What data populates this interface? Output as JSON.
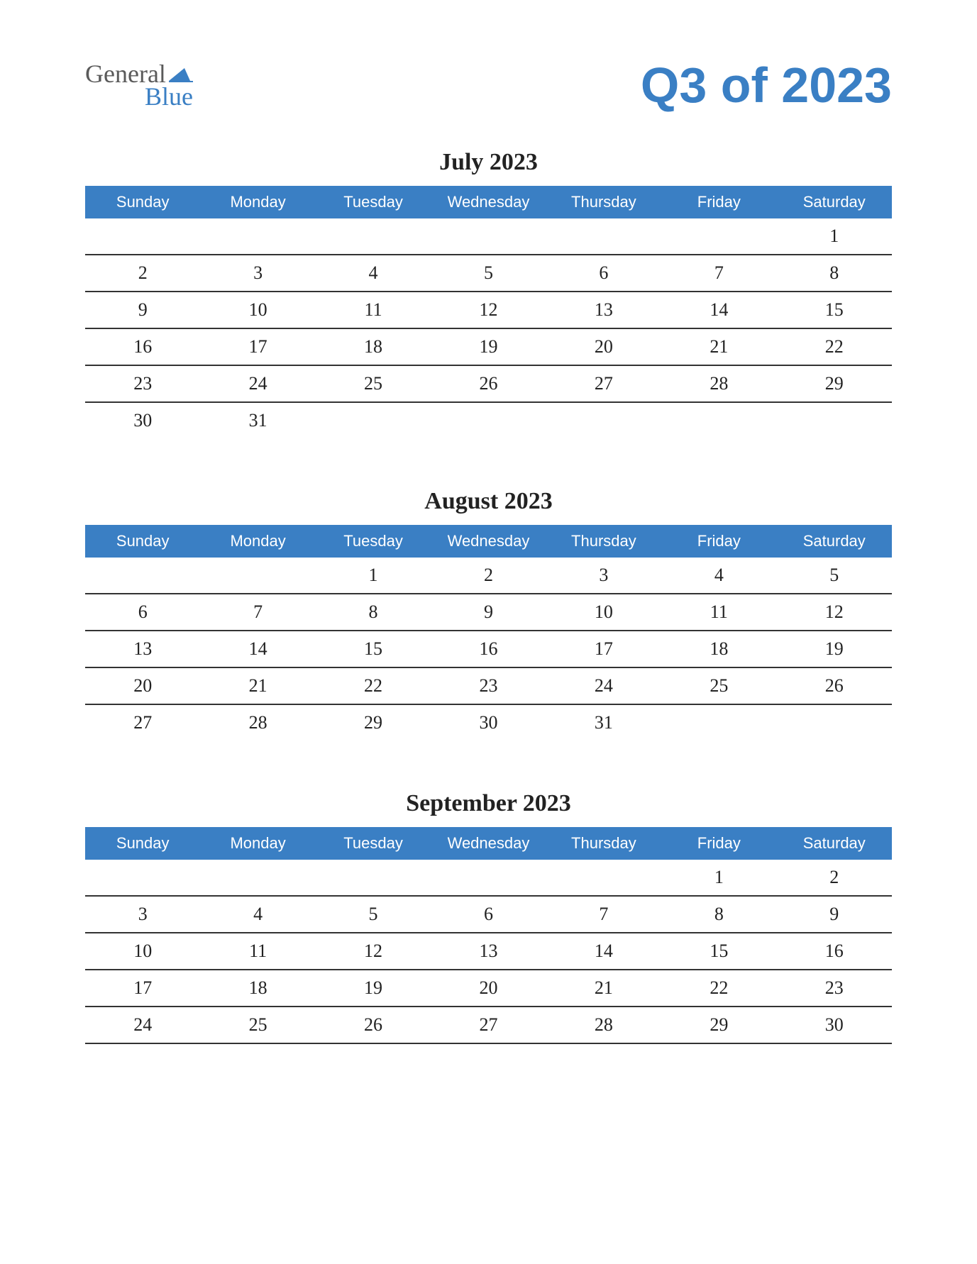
{
  "brand": {
    "word1": "General",
    "word2": "Blue"
  },
  "title": "Q3 of 2023",
  "day_headers": [
    "Sunday",
    "Monday",
    "Tuesday",
    "Wednesday",
    "Thursday",
    "Friday",
    "Saturday"
  ],
  "months": [
    {
      "title": "July 2023",
      "weeks": [
        [
          "",
          "",
          "",
          "",
          "",
          "",
          "1"
        ],
        [
          "2",
          "3",
          "4",
          "5",
          "6",
          "7",
          "8"
        ],
        [
          "9",
          "10",
          "11",
          "12",
          "13",
          "14",
          "15"
        ],
        [
          "16",
          "17",
          "18",
          "19",
          "20",
          "21",
          "22"
        ],
        [
          "23",
          "24",
          "25",
          "26",
          "27",
          "28",
          "29"
        ],
        [
          "30",
          "31",
          "",
          "",
          "",
          "",
          ""
        ]
      ]
    },
    {
      "title": "August 2023",
      "weeks": [
        [
          "",
          "",
          "1",
          "2",
          "3",
          "4",
          "5"
        ],
        [
          "6",
          "7",
          "8",
          "9",
          "10",
          "11",
          "12"
        ],
        [
          "13",
          "14",
          "15",
          "16",
          "17",
          "18",
          "19"
        ],
        [
          "20",
          "21",
          "22",
          "23",
          "24",
          "25",
          "26"
        ],
        [
          "27",
          "28",
          "29",
          "30",
          "31",
          "",
          ""
        ]
      ]
    },
    {
      "title": "September 2023",
      "weeks": [
        [
          "",
          "",
          "",
          "",
          "",
          "1",
          "2"
        ],
        [
          "3",
          "4",
          "5",
          "6",
          "7",
          "8",
          "9"
        ],
        [
          "10",
          "11",
          "12",
          "13",
          "14",
          "15",
          "16"
        ],
        [
          "17",
          "18",
          "19",
          "20",
          "21",
          "22",
          "23"
        ],
        [
          "24",
          "25",
          "26",
          "27",
          "28",
          "29",
          "30"
        ]
      ]
    }
  ],
  "colors": {
    "accent": "#3a7fc4"
  }
}
